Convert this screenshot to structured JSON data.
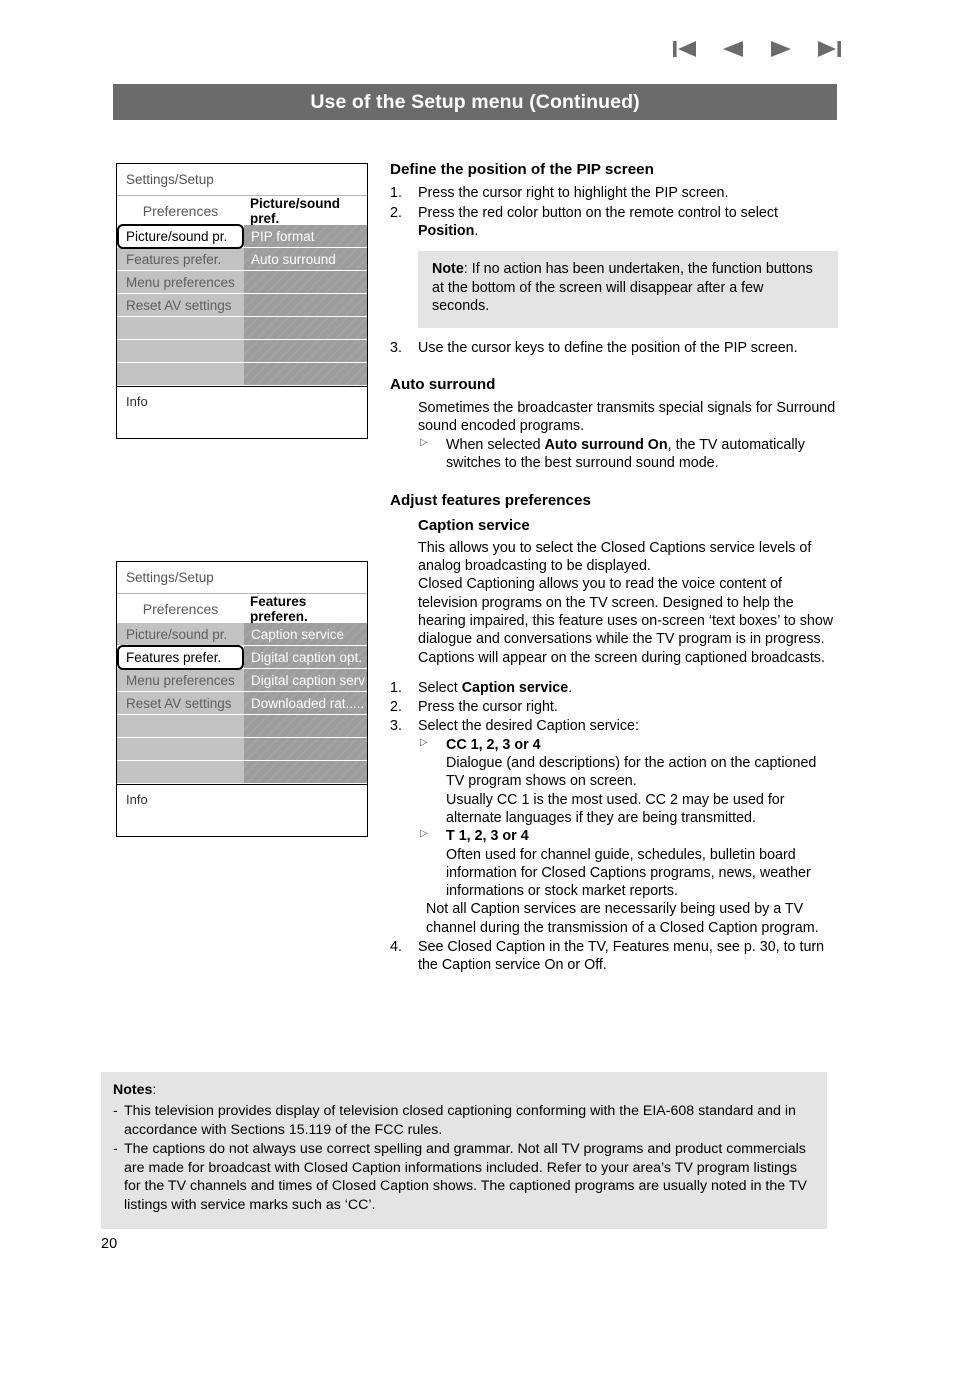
{
  "nav": {
    "first_icon": "skip-to-first-icon",
    "prev_icon": "previous-page-icon",
    "next_icon": "next-page-icon",
    "last_icon": "skip-to-last-icon"
  },
  "header": {
    "title": "Use of the Setup menu (Continued)",
    "bar_color": "#6b6b6b"
  },
  "osd_menus": [
    {
      "breadcrumb": "Settings/Setup",
      "left_header": "Preferences",
      "right_header": "Picture/sound pref.",
      "left_items": [
        {
          "label": "Picture/sound pr.",
          "selected": true
        },
        {
          "label": "Features prefer.",
          "selected": false
        },
        {
          "label": "Menu preferences",
          "selected": false
        },
        {
          "label": "Reset AV settings",
          "selected": false
        },
        {
          "label": "",
          "selected": false
        },
        {
          "label": "",
          "selected": false
        },
        {
          "label": "",
          "selected": false
        }
      ],
      "right_items": [
        "PIP format",
        "Auto surround",
        "",
        "",
        "",
        "",
        ""
      ],
      "info_label": "Info"
    },
    {
      "breadcrumb": "Settings/Setup",
      "left_header": "Preferences",
      "right_header": "Features preferen.",
      "left_items": [
        {
          "label": "Picture/sound pr.",
          "selected": false
        },
        {
          "label": "Features prefer.",
          "selected": true
        },
        {
          "label": "Menu preferences",
          "selected": false
        },
        {
          "label": "Reset AV settings",
          "selected": false
        },
        {
          "label": "",
          "selected": false
        },
        {
          "label": "",
          "selected": false
        },
        {
          "label": "",
          "selected": false
        }
      ],
      "right_items": [
        "Caption service",
        "Digital caption opt.",
        "Digital caption serv",
        "Downloaded rat.....",
        "",
        "",
        ""
      ],
      "info_label": "Info"
    }
  ],
  "sections": {
    "pip": {
      "heading": "Define the position of the PIP screen",
      "step1_num": "1.",
      "step1_text": "Press the cursor right to highlight the PIP screen.",
      "step2_num": "2.",
      "step2_text_a": "Press the red color button on the remote control to select ",
      "step2_bold": "Position",
      "step2_text_b": ".",
      "note_label": "Note",
      "note_text": ": If no action has been undertaken, the function buttons at the bottom of the screen will disappear after a few seconds.",
      "step3_num": "3.",
      "step3_text": "Use the cursor keys to define the position of the PIP screen."
    },
    "auto_surround": {
      "heading": "Auto surround",
      "para": "Sometimes the broadcaster transmits special signals for Surround sound encoded programs.",
      "bullet_a": "When selected ",
      "bullet_bold": "Auto surround On",
      "bullet_b": ", the TV automatically switches to the best surround sound mode."
    },
    "adjust_features": {
      "heading": "Adjust features preferences",
      "subheading": "Caption service",
      "para1": "This allows you to select the Closed Captions service levels of analog broadcasting to be displayed.",
      "para2": "Closed Captioning allows you to read the voice content of television programs on the TV screen. Designed to help the hearing impaired, this feature uses on-screen ‘text boxes’ to show dialogue and conversations while the TV program is in progress. Captions will appear on the screen during captioned broadcasts.",
      "step1_num": "1.",
      "step1_text_a": "Select ",
      "step1_bold": "Caption service",
      "step1_text_b": ".",
      "step2_num": "2.",
      "step2_text": "Press the cursor right.",
      "step3_num": "3.",
      "step3_text": "Select the desired Caption service:",
      "cc_title": "CC 1, 2, 3 or 4",
      "cc_body1": "Dialogue (and descriptions) for the action on the captioned TV program shows on screen.",
      "cc_body2": "Usually CC 1 is the most used. CC 2 may be used for alternate languages if they are being transmitted.",
      "t_title": "T 1, 2, 3 or 4",
      "t_body": "Often used for channel guide, schedules, bulletin board information for Closed Captions programs, news, weather informations or stock market reports.",
      "not_all": "Not all Caption services are necessarily being used by a TV channel during the transmission of a Closed Caption program.",
      "step4_num": "4.",
      "step4_text": "See Closed Caption in the TV, Features menu, see p. 30, to turn the Caption service On or Off."
    }
  },
  "bottom_notes": {
    "label": "Notes",
    "colon": ":",
    "items": [
      "This television provides display of television closed captioning conforming with the EIA-608 standard and in accordance with Sections 15.119 of the FCC rules.",
      "The captions do not always use correct spelling and grammar. Not all TV programs and product commercials are made for broadcast with Closed Caption informations included. Refer to your area’s TV program listings for the TV channels and times of Closed Caption shows. The captioned programs are usually noted in the TV listings with service marks such as ‘CC’."
    ]
  },
  "page_number": "20"
}
